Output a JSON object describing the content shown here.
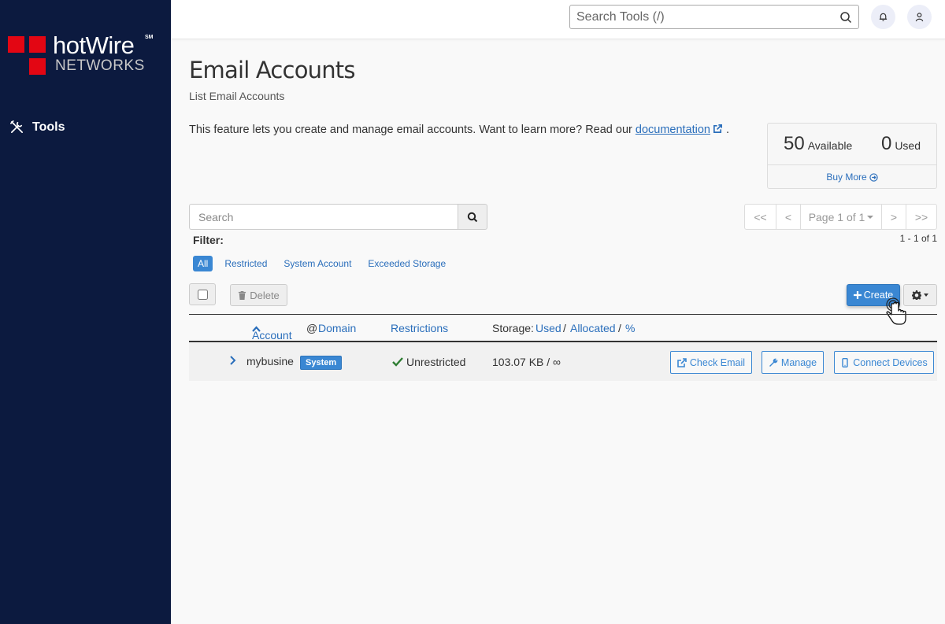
{
  "brand": {
    "name": "hotWire",
    "sm": "SM",
    "sub": "NETWORKS",
    "red": "#e30613"
  },
  "sidebar": {
    "items": [
      {
        "label": "Tools",
        "icon": "tools-icon"
      }
    ]
  },
  "topbar": {
    "search_placeholder": "Search Tools (/)"
  },
  "page": {
    "title": "Email Accounts",
    "subtitle": "List Email Accounts",
    "description": "This feature lets you create and manage email accounts. Want to learn more? Read our ",
    "doc_link": "documentation",
    "desc_end": "."
  },
  "stats": {
    "available_num": "50",
    "available_label": "Available",
    "used_num": "0",
    "used_label": "Used",
    "buy_more": "Buy More"
  },
  "search": {
    "placeholder": "Search"
  },
  "filter": {
    "label": "Filter:",
    "options": [
      "All",
      "Restricted",
      "System Account",
      "Exceeded Storage"
    ],
    "active": "All"
  },
  "pager": {
    "first": "<<",
    "prev": "<",
    "page": "Page 1 of 1",
    "next": ">",
    "last": ">>",
    "range": "1 - 1 of 1"
  },
  "toolbar": {
    "delete": "Delete",
    "create": "Create"
  },
  "table": {
    "headers": {
      "account": "Account",
      "at": "@",
      "domain": "Domain",
      "restrictions": "Restrictions",
      "storage": "Storage:",
      "used": "Used",
      "slash1": "/",
      "allocated": "Allocated",
      "slash2": "/",
      "pct": "%"
    },
    "rows": [
      {
        "account": "mybusine",
        "badge": "System",
        "restriction": "Unrestricted",
        "storage": "103.07 KB / ∞",
        "actions": [
          "Check Email",
          "Manage",
          "Connect Devices"
        ]
      }
    ]
  },
  "colors": {
    "sidebar": "#0c1a3f",
    "primary": "#3a87d3",
    "link": "#2a6ebb",
    "success": "#2e7d32"
  }
}
